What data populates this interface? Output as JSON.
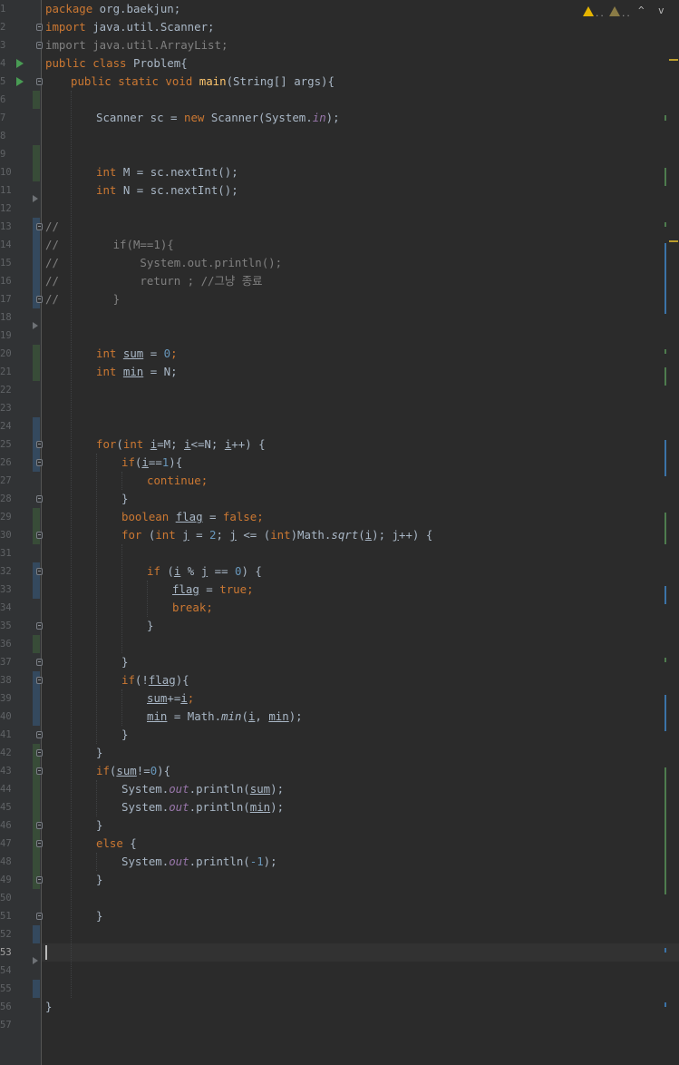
{
  "editor": {
    "lines": [
      {
        "n": "1"
      },
      {
        "n": "2"
      },
      {
        "n": "3"
      },
      {
        "n": "4"
      },
      {
        "n": "5"
      },
      {
        "n": "6"
      },
      {
        "n": "7"
      },
      {
        "n": "8"
      },
      {
        "n": "9"
      },
      {
        "n": "10"
      },
      {
        "n": "11"
      },
      {
        "n": "12"
      },
      {
        "n": "13"
      },
      {
        "n": "14"
      },
      {
        "n": "15"
      },
      {
        "n": "16"
      },
      {
        "n": "17"
      },
      {
        "n": "18"
      },
      {
        "n": "19"
      },
      {
        "n": "20"
      },
      {
        "n": "21"
      },
      {
        "n": "22"
      },
      {
        "n": "23"
      },
      {
        "n": "24"
      },
      {
        "n": "25"
      },
      {
        "n": "26"
      },
      {
        "n": "27"
      },
      {
        "n": "28"
      },
      {
        "n": "29"
      },
      {
        "n": "30"
      },
      {
        "n": "31"
      },
      {
        "n": "32"
      },
      {
        "n": "33"
      },
      {
        "n": "34"
      },
      {
        "n": "35"
      },
      {
        "n": "36"
      },
      {
        "n": "37"
      },
      {
        "n": "38"
      },
      {
        "n": "39"
      },
      {
        "n": "40"
      },
      {
        "n": "41"
      },
      {
        "n": "42"
      },
      {
        "n": "43"
      },
      {
        "n": "44"
      },
      {
        "n": "45"
      },
      {
        "n": "46"
      },
      {
        "n": "47"
      },
      {
        "n": "48"
      },
      {
        "n": "49"
      },
      {
        "n": "50"
      },
      {
        "n": "51"
      },
      {
        "n": "52"
      },
      {
        "n": "53"
      },
      {
        "n": "54"
      },
      {
        "n": "55"
      },
      {
        "n": "56"
      },
      {
        "n": "57"
      }
    ],
    "code": {
      "l1_kw": "package",
      "l1_rest": " org.baekjun;",
      "l2_kw": "import",
      "l2_rest": " java.util.Scanner;",
      "l3": "import java.util.ArrayList;",
      "l4_kw": "public class",
      "l4_rest": " Problem{",
      "l5_kw": "public static void",
      "l5_fn": "main",
      "l5_rest": "(String[] args){",
      "l7_a": "Scanner sc = ",
      "l7_kw": "new",
      "l7_b": " Scanner(System.",
      "l7_st": "in",
      "l7_c": ");",
      "l10_kw": "int",
      "l10_rest": " M = sc.nextInt();",
      "l11_kw": "int",
      "l11_rest": " N = sc.nextInt();",
      "l13": "//",
      "l14": "//        if(M==1){",
      "l15": "//            System.out.println();",
      "l16": "//            return ; //그냥 종료",
      "l17": "//        }",
      "l20_kw": "int",
      "l20_var": "sum",
      "l20_mid": " = ",
      "l20_num": "0",
      "l20_end": ";",
      "l21_kw": "int",
      "l21_var": "min",
      "l21_end": " = N;",
      "l25_kw1": "for",
      "l25_p": "(",
      "l25_kw2": "int",
      "l25_i": "i",
      "l25_a": "=M; ",
      "l25_i2": "i",
      "l25_b": "<=N; ",
      "l25_i3": "i",
      "l25_c": "++) {",
      "l26_kw": "if",
      "l26_p": "(",
      "l26_i": "i",
      "l26_a": "==",
      "l26_num": "1",
      "l26_b": "){",
      "l27_kw": "continue",
      "l27_end": ";",
      "l28": "}",
      "l29_kw": "boolean",
      "l29_var": "flag",
      "l29_a": " = ",
      "l29_kw2": "false",
      "l29_end": ";",
      "l30_kw": "for",
      "l30_p": " (",
      "l30_kw2": "int",
      "l30_j": "j",
      "l30_a": " = ",
      "l30_num": "2",
      "l30_b": "; ",
      "l30_j2": "j",
      "l30_c": " <= (",
      "l30_kw3": "int",
      "l30_d": ")Math.",
      "l30_fn": "sqrt",
      "l30_e": "(",
      "l30_i": "i",
      "l30_f": "); ",
      "l30_j3": "j",
      "l30_g": "++) {",
      "l32_kw": "if",
      "l32_a": " (",
      "l32_i": "i",
      "l32_b": " % ",
      "l32_j": "j",
      "l32_c": " == ",
      "l32_num": "0",
      "l32_d": ") {",
      "l33_var": "flag",
      "l33_a": " = ",
      "l33_kw": "true",
      "l33_end": ";",
      "l34_kw": "break",
      "l34_end": ";",
      "l35": "}",
      "l37": "}",
      "l38_kw": "if",
      "l38_a": "(!",
      "l38_var": "flag",
      "l38_b": "){",
      "l39_var": "sum",
      "l39_a": "+=",
      "l39_i": "i",
      "l39_end": ";",
      "l40_var": "min",
      "l40_a": " = Math.",
      "l40_fn": "min",
      "l40_b": "(",
      "l40_i": "i",
      "l40_c": ", ",
      "l40_var2": "min",
      "l40_d": ");",
      "l41": "}",
      "l42": "}",
      "l43_kw": "if",
      "l43_a": "(",
      "l43_var": "sum",
      "l43_b": "!=",
      "l43_num": "0",
      "l43_c": "){",
      "l44_a": "System.",
      "l44_st": "out",
      "l44_b": ".println(",
      "l44_var": "sum",
      "l44_c": ");",
      "l45_a": "System.",
      "l45_st": "out",
      "l45_b": ".println(",
      "l45_var": "min",
      "l45_c": ");",
      "l46": "}",
      "l47_kw": "else",
      "l47_rest": " {",
      "l48_a": "System.",
      "l48_st": "out",
      "l48_b": ".println(",
      "l48_num": "-1",
      "l48_c": ");",
      "l49": "}",
      "l51": "}",
      "l56": "}"
    },
    "current_line": "53"
  },
  "inspection": {
    "warnings_a": "..",
    "warnings_b": "..",
    "prev_arrow": "^",
    "next_arrow": "v"
  },
  "colors": {
    "background": "#2b2b2b",
    "gutter": "#313335",
    "keyword": "#cc7832",
    "number": "#6897bb",
    "function": "#ffc66d",
    "comment": "#808080",
    "static_field": "#9876aa",
    "text": "#a9b7c6"
  }
}
